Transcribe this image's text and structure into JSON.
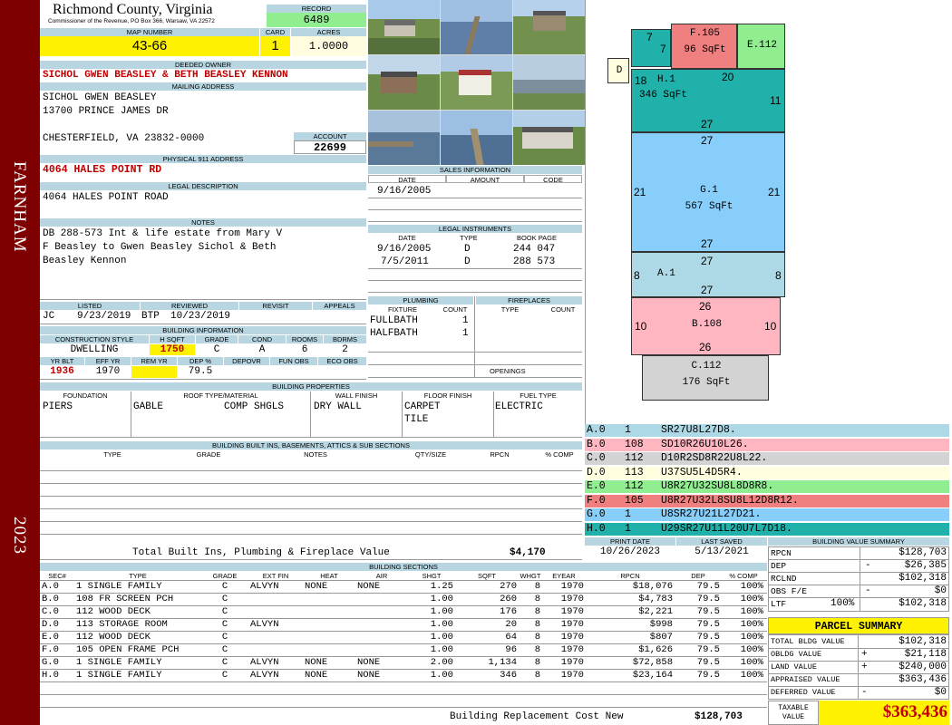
{
  "sidebar": {
    "town": "FARNHAM",
    "year": "2023"
  },
  "header": {
    "county": "Richmond County, Virginia",
    "commissioner": "Commissioner of the Revenue, PO Box 366, Warsaw, VA 22572",
    "record_label": "RECORD",
    "record": "6489",
    "map_label": "MAP NUMBER",
    "map_number": "43-66",
    "card_label": "CARD",
    "card": "1",
    "acres_label": "ACRES",
    "acres": "1.0000"
  },
  "owner": {
    "deeded_label": "DEEDED OWNER",
    "deeded": "SICHOL GWEN BEASLEY & BETH BEASLEY KENNON",
    "mailing_label": "MAILING ADDRESS",
    "mail1": "SICHOL GWEN BEASLEY",
    "mail2": "13700 PRINCE JAMES DR",
    "mail3": "CHESTERFIELD, VA 23832-0000",
    "account_label": "ACCOUNT",
    "account": "22699",
    "physical_label": "PHYSICAL 911 ADDRESS",
    "physical": "4064 HALES POINT RD",
    "legal_label": "LEGAL DESCRIPTION",
    "legal": "4064 HALES POINT ROAD",
    "notes_label": "NOTES",
    "notes1": "DB 288-573 Int & life estate from Mary V",
    "notes2": "F Beasley to Gwen Beasley Sichol & Beth",
    "notes3": "Beasley Kennon"
  },
  "listing": {
    "listed_label": "LISTED",
    "reviewed_label": "REVIEWED",
    "revisit_label": "REVISIT",
    "appeals_label": "APPEALS",
    "listed_by": "JC",
    "listed_date": "9/23/2019",
    "reviewed_by": "BTP",
    "reviewed_date": "10/23/2019"
  },
  "building_info": {
    "title": "BUILDING INFORMATION",
    "h_style": "CONSTRUCTION STYLE",
    "h_sqft": "H SQFT",
    "h_grade": "GRADE",
    "h_cond": "COND",
    "h_rooms": "ROOMS",
    "h_bdrms": "BDRMS",
    "style": "DWELLING",
    "sqft": "1750",
    "grade": "C",
    "cond": "A",
    "rooms": "6",
    "bdrms": "2",
    "h_yrblt": "YR BLT",
    "h_effyr": "EFF YR",
    "h_remyr": "REM YR",
    "h_dep": "DEP %",
    "h_depovr": "DEPOVR",
    "h_funobs": "FUN OBS",
    "h_ecoobs": "ECO OBS",
    "yrblt": "1936",
    "effyr": "1970",
    "dep": "79.5"
  },
  "sales": {
    "title": "SALES INFORMATION",
    "h_date": "DATE",
    "h_amount": "AMOUNT",
    "h_code": "CODE",
    "date1": "9/16/2005"
  },
  "legal_instruments": {
    "title": "LEGAL INSTRUMENTS",
    "h_date": "DATE",
    "h_type": "TYPE",
    "h_book": "BOOK PAGE",
    "rows": [
      {
        "date": "9/16/2005",
        "type": "D",
        "book": "244 047"
      },
      {
        "date": "7/5/2011",
        "type": "D",
        "book": "288 573"
      }
    ]
  },
  "plumbing": {
    "title": "PLUMBING",
    "h_fixture": "FIXTURE",
    "h_count": "COUNT",
    "rows": [
      {
        "fixture": "FULLBATH",
        "count": "1"
      },
      {
        "fixture": "HALFBATH",
        "count": "1"
      }
    ]
  },
  "fireplaces": {
    "title": "FIREPLACES",
    "h_type": "TYPE",
    "h_count": "COUNT",
    "openings": "OPENINGS"
  },
  "properties": {
    "title": "BUILDING PROPERTIES",
    "h_foundation": "FOUNDATION",
    "h_roof": "ROOF TYPE/MATERIAL",
    "h_wall": "WALL FINISH",
    "h_floor": "FLOOR FINISH",
    "h_fuel": "FUEL TYPE",
    "foundation": "PIERS",
    "roof_type": "GABLE",
    "roof_mat": "COMP SHGLS",
    "wall": "DRY WALL",
    "floor1": "CARPET",
    "floor2": "TILE",
    "fuel": "ELECTRIC"
  },
  "built_ins": {
    "title": "BUILDING BUILT INS, BASEMENTS, ATTICS & SUB SECTIONS",
    "h_type": "TYPE",
    "h_grade": "GRADE",
    "h_notes": "NOTES",
    "h_qty": "QTY/SIZE",
    "h_rpcn": "RPCN",
    "h_comp": "% COMP",
    "total_label": "Total Built Ins, Plumbing & Fireplace Value",
    "total": "$4,170"
  },
  "dates": {
    "print_label": "PRINT DATE",
    "saved_label": "LAST SAVED",
    "print": "10/26/2023",
    "saved": "5/13/2021"
  },
  "sections": {
    "title": "BUILDING SECTIONS",
    "headers": [
      "SEC#",
      "TYPE",
      "GRADE",
      "EXT FIN",
      "HEAT",
      "AIR",
      "SHGT",
      "SQFT",
      "WHGT",
      "EYEAR",
      "RPCN",
      "DEP",
      "% COMP"
    ],
    "rows": [
      [
        "A.0",
        "1 SINGLE FAMILY",
        "C",
        "ALVYN",
        "NONE",
        "NONE",
        "1.25",
        "270",
        "8",
        "1970",
        "$18,076",
        "79.5",
        "100%"
      ],
      [
        "B.0",
        "108 FR SCREEN PCH",
        "C",
        "",
        "",
        "",
        "1.00",
        "260",
        "8",
        "1970",
        "$4,783",
        "79.5",
        "100%"
      ],
      [
        "C.0",
        "112 WOOD DECK",
        "C",
        "",
        "",
        "",
        "1.00",
        "176",
        "8",
        "1970",
        "$2,221",
        "79.5",
        "100%"
      ],
      [
        "D.0",
        "113 STORAGE ROOM",
        "C",
        "ALVYN",
        "",
        "",
        "1.00",
        "20",
        "8",
        "1970",
        "$998",
        "79.5",
        "100%"
      ],
      [
        "E.0",
        "112 WOOD DECK",
        "C",
        "",
        "",
        "",
        "1.00",
        "64",
        "8",
        "1970",
        "$807",
        "79.5",
        "100%"
      ],
      [
        "F.0",
        "105 OPEN FRAME PCH",
        "C",
        "",
        "",
        "",
        "1.00",
        "96",
        "8",
        "1970",
        "$1,626",
        "79.5",
        "100%"
      ],
      [
        "G.0",
        "1 SINGLE FAMILY",
        "C",
        "ALVYN",
        "NONE",
        "NONE",
        "2.00",
        "1,134",
        "8",
        "1970",
        "$72,858",
        "79.5",
        "100%"
      ],
      [
        "H.0",
        "1 SINGLE FAMILY",
        "C",
        "ALVYN",
        "NONE",
        "NONE",
        "1.00",
        "346",
        "8",
        "1970",
        "$23,164",
        "79.5",
        "100%"
      ]
    ],
    "replacement_label": "Building Replacement Cost New",
    "replacement": "$128,703"
  },
  "sketch": {
    "shapes": [
      {
        "id": "F",
        "label": "F.105",
        "area": "96 SqFt",
        "color": "#f08080"
      },
      {
        "id": "E",
        "label": "E.112",
        "area": "",
        "color": "#90ee90"
      },
      {
        "id": "D",
        "label": "D",
        "area": "",
        "color": "#ffffe0"
      },
      {
        "id": "H",
        "label": "H.1",
        "area": "346 SqFt",
        "color": "#20b2aa"
      },
      {
        "id": "G",
        "label": "G.1",
        "area": "567 SqFt",
        "color": "#87cefa"
      },
      {
        "id": "A",
        "label": "A.1",
        "area": "",
        "color": "#add8e6"
      },
      {
        "id": "B",
        "label": "B.108",
        "area": "",
        "color": "#ffb6c1"
      },
      {
        "id": "C",
        "label": "C.112",
        "area": "176 SqFt",
        "color": "#d3d3d3"
      }
    ],
    "dims": {
      "h7a": "7",
      "h7b": "7",
      "h18": "18",
      "h20": "20",
      "h11": "11",
      "h27a": "27",
      "g27a": "27",
      "g21a": "21",
      "g21b": "21",
      "g27b": "27",
      "a27a": "27",
      "a8a": "8",
      "a8b": "8",
      "a27b": "27",
      "b26a": "26",
      "b10a": "10",
      "b10b": "10",
      "b26b": "26"
    }
  },
  "legend": [
    {
      "sec": "A.0",
      "code": "1",
      "path": "SR27U8L27D8.",
      "color": "#add8e6"
    },
    {
      "sec": "B.0",
      "code": "108",
      "path": "SD10R26U10L26.",
      "color": "#ffb6c1"
    },
    {
      "sec": "C.0",
      "code": "112",
      "path": "D10R2SD8R22U8L22.",
      "color": "#d3d3d3"
    },
    {
      "sec": "D.0",
      "code": "113",
      "path": "U37SU5L4D5R4.",
      "color": "#ffffe0"
    },
    {
      "sec": "E.0",
      "code": "112",
      "path": "U8R27U32SU8L8D8R8.",
      "color": "#90ee90"
    },
    {
      "sec": "F.0",
      "code": "105",
      "path": "U8R27U32L8SU8L12D8R12.",
      "color": "#f08080"
    },
    {
      "sec": "G.0",
      "code": "1",
      "path": "U8SR27U21L27D21.",
      "color": "#87cefa"
    },
    {
      "sec": "H.0",
      "code": "1",
      "path": "U29SR27U11L20U7L7D18.",
      "color": "#20b2aa"
    }
  ],
  "value_summary": {
    "title": "BUILDING VALUE SUMMARY",
    "rpcn_label": "RPCN",
    "rpcn": "$128,703",
    "dep_label": "DEP",
    "dep_sign": "-",
    "dep": "$26,385",
    "rclnd_label": "RCLND",
    "rclnd": "$102,318",
    "obsfe_label": "OBS F/E",
    "obsfe_sign": "-",
    "obsfe": "$0",
    "ltf_label": "LTF",
    "ltf_pct": "100%",
    "ltf": "$102,318"
  },
  "parcel": {
    "title": "PARCEL SUMMARY",
    "bldg_label": "TOTAL BLDG VALUE",
    "bldg": "$102,318",
    "obldg_label": "OBLDG VALUE",
    "obldg_sign": "+",
    "obldg": "$21,118",
    "land_label": "LAND VALUE",
    "land_sign": "+",
    "land": "$240,000",
    "appraised_label": "APPRAISED VALUE",
    "appraised": "$363,436",
    "deferred_label": "DEFERRED VALUE",
    "deferred_sign": "-",
    "deferred": "$0",
    "taxable_label1": "TAXABLE",
    "taxable_label2": "VALUE",
    "taxable": "$363,436"
  },
  "photos": [
    "house-photo-1",
    "pier-photo",
    "stilt-house-photo",
    "cottage-photo",
    "shed-photo",
    "shoreline-photo",
    "water-dock-photo",
    "long-pier-photo",
    "porch-photo"
  ]
}
